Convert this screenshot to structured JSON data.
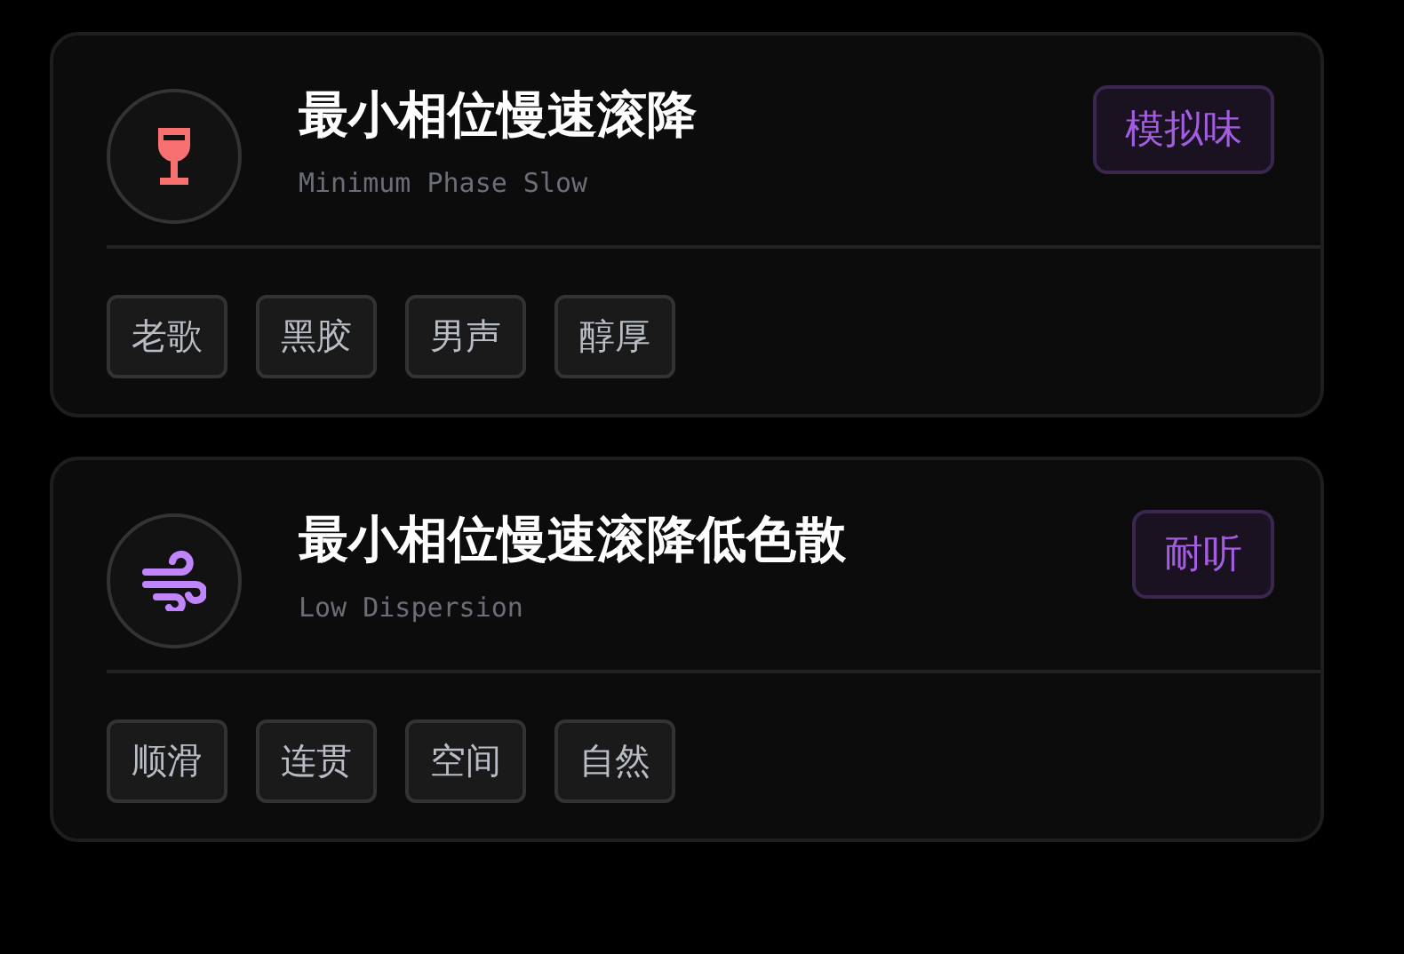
{
  "cards": [
    {
      "kind": "glass",
      "color": "#f87171",
      "title": "最小相位慢速滚降",
      "subtitle": "Minimum Phase Slow",
      "badge": "模拟味",
      "tags": [
        "老歌",
        "黑胶",
        "男声",
        "醇厚"
      ]
    },
    {
      "kind": "wind",
      "color": "#c084fc",
      "title": "最小相位慢速滚降低色散",
      "subtitle": "Low Dispersion",
      "badge": "耐听",
      "tags": [
        "顺滑",
        "连贯",
        "空间",
        "自然"
      ]
    }
  ]
}
